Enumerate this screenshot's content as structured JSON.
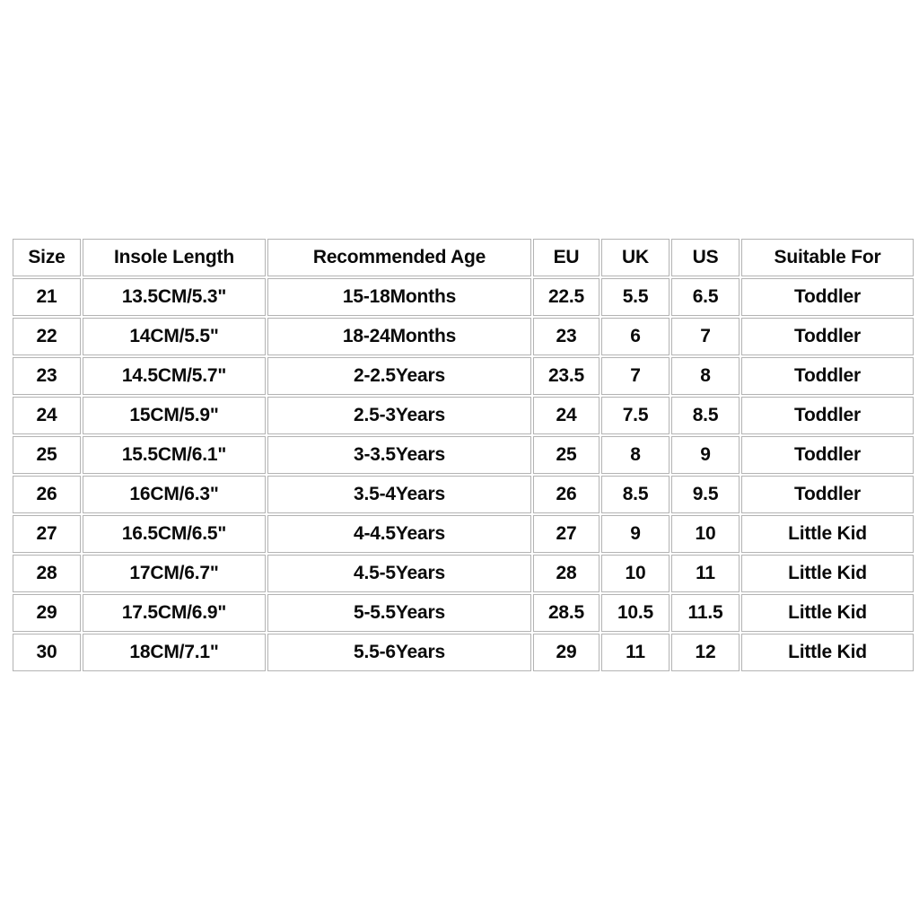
{
  "table": {
    "columns": [
      {
        "key": "size",
        "label": "Size"
      },
      {
        "key": "insole",
        "label": "Insole Length"
      },
      {
        "key": "age",
        "label": "Recommended Age"
      },
      {
        "key": "eu",
        "label": "EU"
      },
      {
        "key": "uk",
        "label": "UK"
      },
      {
        "key": "us",
        "label": "US"
      },
      {
        "key": "suit",
        "label": "Suitable For"
      }
    ],
    "rows": [
      {
        "size": "21",
        "insole": "13.5CM/5.3\"",
        "age": "15-18Months",
        "eu": "22.5",
        "uk": "5.5",
        "us": "6.5",
        "suit": "Toddler"
      },
      {
        "size": "22",
        "insole": "14CM/5.5\"",
        "age": "18-24Months",
        "eu": "23",
        "uk": "6",
        "us": "7",
        "suit": "Toddler"
      },
      {
        "size": "23",
        "insole": "14.5CM/5.7\"",
        "age": "2-2.5Years",
        "eu": "23.5",
        "uk": "7",
        "us": "8",
        "suit": "Toddler"
      },
      {
        "size": "24",
        "insole": "15CM/5.9\"",
        "age": "2.5-3Years",
        "eu": "24",
        "uk": "7.5",
        "us": "8.5",
        "suit": "Toddler"
      },
      {
        "size": "25",
        "insole": "15.5CM/6.1\"",
        "age": "3-3.5Years",
        "eu": "25",
        "uk": "8",
        "us": "9",
        "suit": "Toddler"
      },
      {
        "size": "26",
        "insole": "16CM/6.3\"",
        "age": "3.5-4Years",
        "eu": "26",
        "uk": "8.5",
        "us": "9.5",
        "suit": "Toddler"
      },
      {
        "size": "27",
        "insole": "16.5CM/6.5\"",
        "age": "4-4.5Years",
        "eu": "27",
        "uk": "9",
        "us": "10",
        "suit": "Little Kid"
      },
      {
        "size": "28",
        "insole": "17CM/6.7\"",
        "age": "4.5-5Years",
        "eu": "28",
        "uk": "10",
        "us": "11",
        "suit": "Little Kid"
      },
      {
        "size": "29",
        "insole": "17.5CM/6.9\"",
        "age": "5-5.5Years",
        "eu": "28.5",
        "uk": "10.5",
        "us": "11.5",
        "suit": "Little Kid"
      },
      {
        "size": "30",
        "insole": "18CM/7.1\"",
        "age": "5.5-6Years",
        "eu": "29",
        "uk": "11",
        "us": "12",
        "suit": "Little Kid"
      }
    ]
  },
  "style": {
    "background": "#ffffff",
    "border_color": "#b3b3b3",
    "text_color": "#0a0a0a"
  }
}
